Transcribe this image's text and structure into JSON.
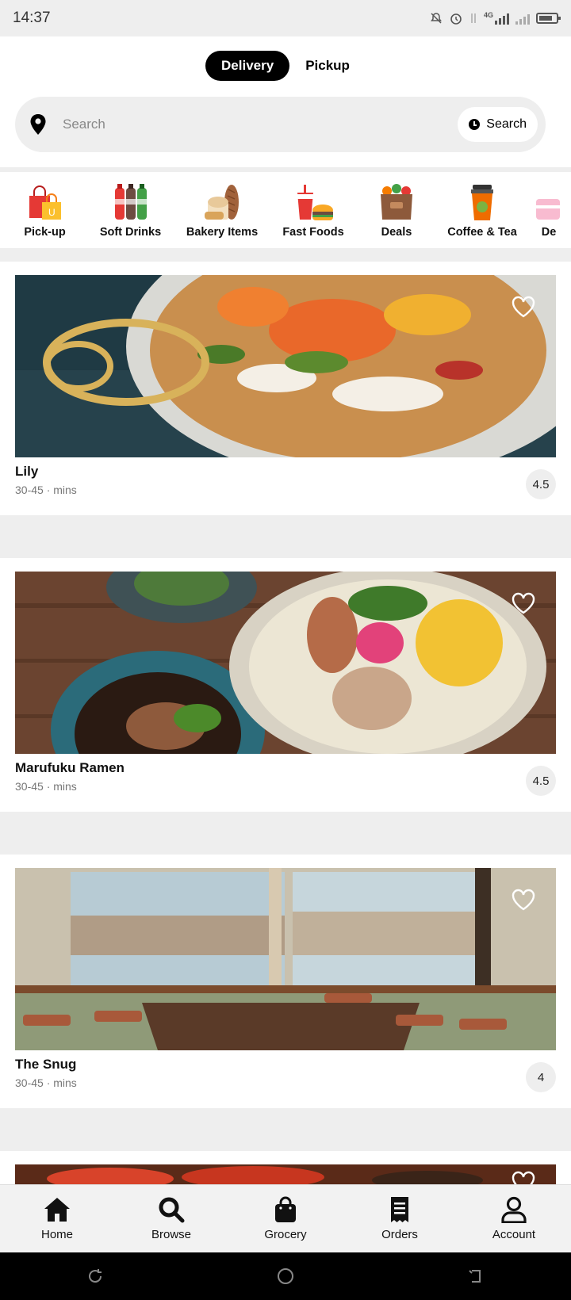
{
  "status_bar": {
    "time": "14:37",
    "network": "4G",
    "icons": [
      "mute-icon",
      "alarm-icon",
      "data-icon",
      "signal-icon",
      "battery-icon"
    ]
  },
  "mode_toggle": {
    "delivery_label": "Delivery",
    "pickup_label": "Pickup",
    "selected": "Delivery"
  },
  "search": {
    "placeholder": "Search",
    "button_label": "Search"
  },
  "categories": [
    {
      "label": "Pick-up",
      "icon": "shopping-bags-icon"
    },
    {
      "label": "Soft Drinks",
      "icon": "soda-bottles-icon"
    },
    {
      "label": "Bakery Items",
      "icon": "bread-icon"
    },
    {
      "label": "Fast Foods",
      "icon": "burger-fries-icon"
    },
    {
      "label": "Deals",
      "icon": "grocery-bag-icon"
    },
    {
      "label": "Coffee & Tea",
      "icon": "coffee-cup-icon"
    },
    {
      "label": "De",
      "icon": "dessert-icon"
    }
  ],
  "restaurants": [
    {
      "name": "Lily",
      "eta": "30-45 · mins",
      "rating": "4.5",
      "photo": "pizza-dish"
    },
    {
      "name": "Marufuku Ramen",
      "eta": "30-45 · mins",
      "rating": "4.5",
      "photo": "ramen-bowls"
    },
    {
      "name": "The Snug",
      "eta": "30-45 · mins",
      "rating": "4",
      "photo": "dining-room"
    }
  ],
  "bottom_nav": [
    {
      "label": "Home",
      "icon": "home-icon"
    },
    {
      "label": "Browse",
      "icon": "search-icon"
    },
    {
      "label": "Grocery",
      "icon": "shopping-bag-icon"
    },
    {
      "label": "Orders",
      "icon": "receipt-icon"
    },
    {
      "label": "Account",
      "icon": "person-icon"
    }
  ],
  "colors": {
    "accent": "#000000",
    "surface": "#ffffff",
    "background": "#eeeeee"
  }
}
